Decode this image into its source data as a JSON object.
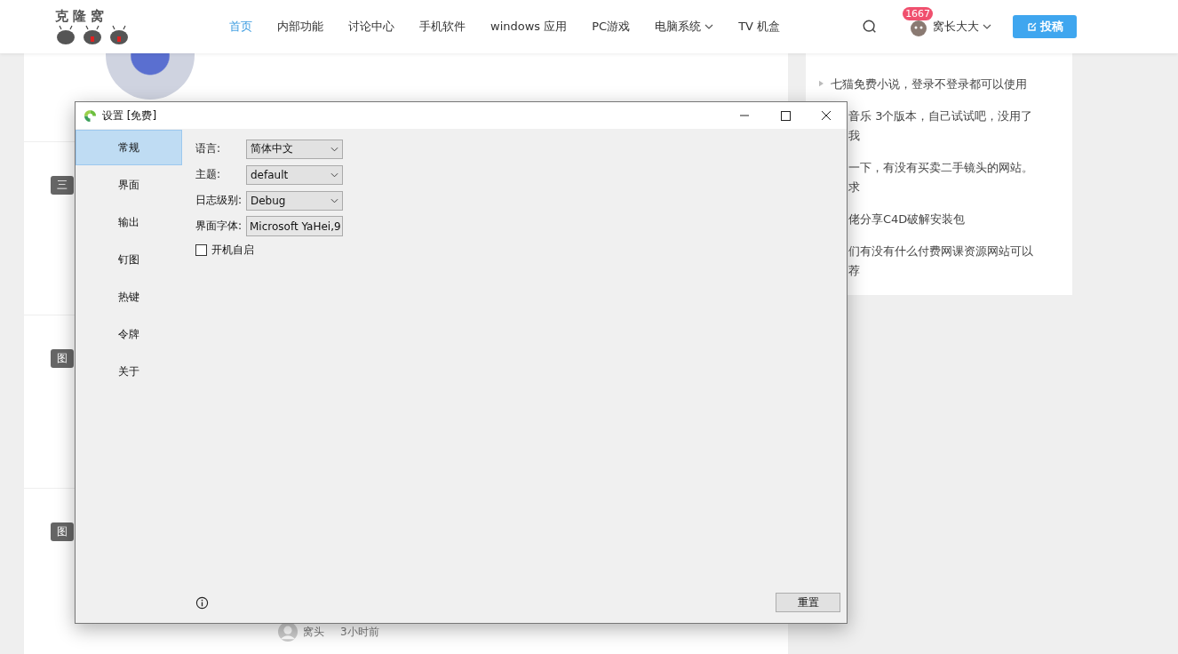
{
  "header": {
    "logo": "克 隆 窝",
    "nav": [
      {
        "label": "首页",
        "selected": true,
        "caret": false
      },
      {
        "label": "内部功能",
        "selected": false,
        "caret": false
      },
      {
        "label": "讨论中心",
        "selected": false,
        "caret": false
      },
      {
        "label": "手机软件",
        "selected": false,
        "caret": false
      },
      {
        "label": "windows 应用",
        "selected": false,
        "caret": false
      },
      {
        "label": "PC游戏",
        "selected": false,
        "caret": false
      },
      {
        "label": "电脑系统",
        "selected": false,
        "caret": true
      },
      {
        "label": "TV 机盒",
        "selected": false,
        "caret": false
      }
    ],
    "badge": "1667",
    "user": "窝长大大",
    "post_button": "投稿"
  },
  "articles": [
    {
      "tag": "三"
    },
    {
      "tag": "图"
    },
    {
      "tag": "图",
      "author": "窝头",
      "time": "3小时前"
    }
  ],
  "sidebar": {
    "items": [
      {
        "text": "七猫免费小说，登录不登录都可以使用",
        "arrow": true
      },
      {
        "text": "音乐 3个版本，自己试试吧，没用了我",
        "arrow": false
      },
      {
        "text": "一下，有没有买卖二手镜头的网站。求",
        "arrow": false
      },
      {
        "text": "佬分享C4D破解安装包",
        "arrow": false
      },
      {
        "text": "们有没有什么付费网课资源网站可以荐",
        "arrow": false
      }
    ]
  },
  "dialog": {
    "title": "设置 [免费]",
    "nav": [
      {
        "label": "常规",
        "selected": true
      },
      {
        "label": "界面",
        "selected": false
      },
      {
        "label": "输出",
        "selected": false
      },
      {
        "label": "钉图",
        "selected": false
      },
      {
        "label": "热键",
        "selected": false
      },
      {
        "label": "令牌",
        "selected": false
      },
      {
        "label": "关于",
        "selected": false
      }
    ],
    "fields": [
      {
        "label": "语言:",
        "kind": "select",
        "value": "简体中文"
      },
      {
        "label": "主题:",
        "kind": "select",
        "value": "default"
      },
      {
        "label": "日志级别:",
        "kind": "select",
        "value": "Debug"
      },
      {
        "label": "界面字体:",
        "kind": "text",
        "value": "Microsoft YaHei,9"
      }
    ],
    "autostart": {
      "label": "开机自启",
      "checked": false
    },
    "reset_button": "重置"
  }
}
